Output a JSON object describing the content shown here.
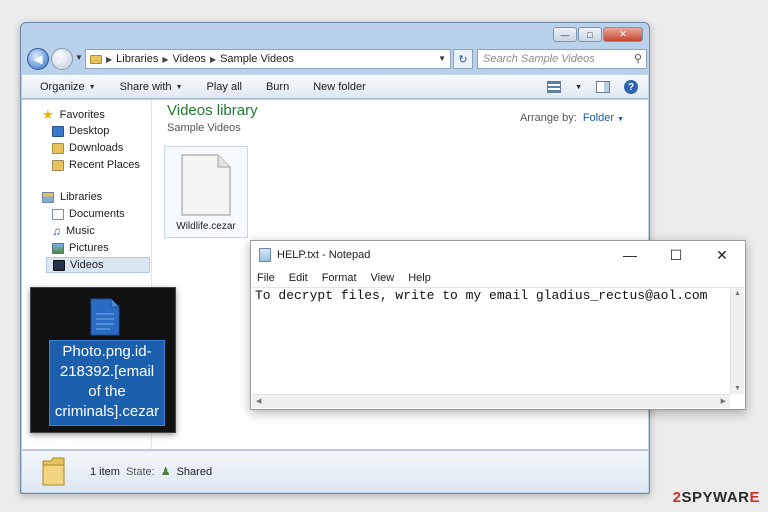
{
  "explorer": {
    "breadcrumb": [
      "Libraries",
      "Videos",
      "Sample Videos"
    ],
    "search_placeholder": "Search Sample Videos",
    "commands": [
      "Organize",
      "Share with",
      "Play all",
      "Burn",
      "New folder"
    ],
    "nav": {
      "favorites_label": "Favorites",
      "favorites": [
        "Desktop",
        "Downloads",
        "Recent Places"
      ],
      "libraries_label": "Libraries",
      "libraries": [
        "Documents",
        "Music",
        "Pictures",
        "Videos"
      ]
    },
    "library_title": "Videos library",
    "library_subtitle": "Sample Videos",
    "arrange_label": "Arrange by:",
    "arrange_value": "Folder",
    "file_name": "Wildlife.cezar",
    "status_count": "1 item",
    "status_state_label": "State:",
    "status_state_value": "Shared"
  },
  "overlay_file": {
    "name": "Photo.png.id-\n218392.[email\nof the\ncriminals].cezar"
  },
  "notepad": {
    "title": "HELP.txt - Notepad",
    "menu": [
      "File",
      "Edit",
      "Format",
      "View",
      "Help"
    ],
    "content": "To decrypt files, write to my email gladius_rectus@aol.com"
  },
  "watermark": {
    "prefix": "2",
    "text": "SPYWAR",
    "suffix": "E"
  }
}
